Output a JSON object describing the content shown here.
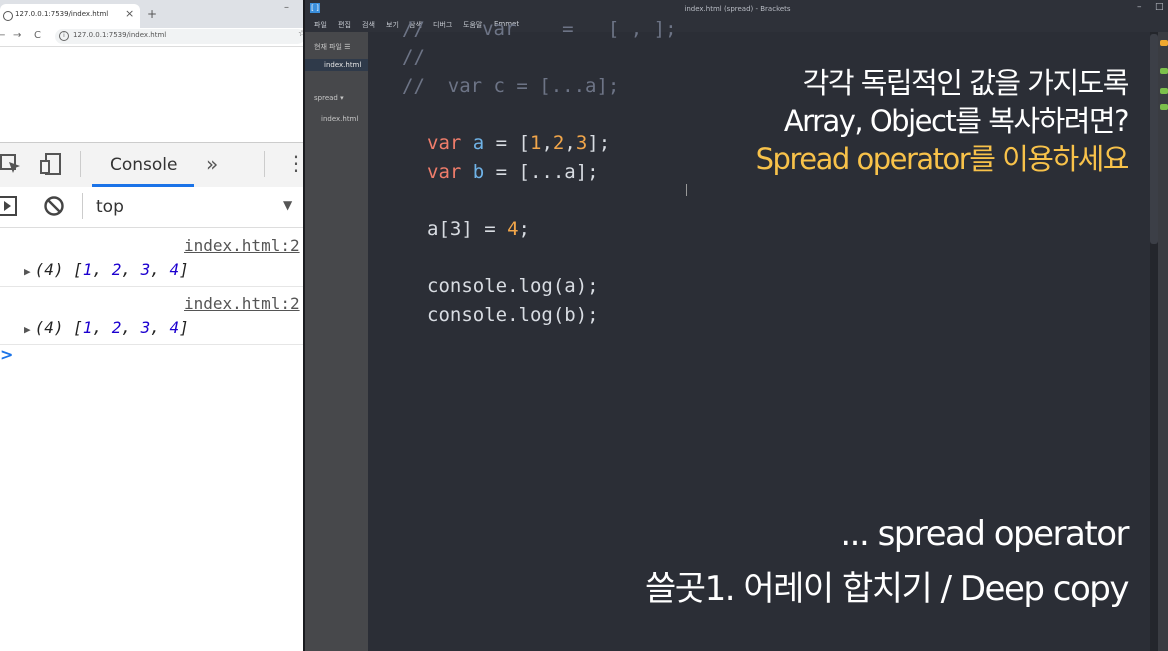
{
  "browser": {
    "tab_title": "127.0.0.1:7539/index.html",
    "tab_close": "×",
    "new_tab": "+",
    "minimize": "–",
    "back": "←",
    "forward": "→",
    "reload": "C",
    "url": "127.0.0.1:7539/index.html"
  },
  "devtools": {
    "console_tab": "Console",
    "more_tabs": "»",
    "context": "top",
    "logs": [
      {
        "source": "index.html:2",
        "count": "(4)",
        "values": [
          "1",
          "2",
          "3",
          "4"
        ]
      },
      {
        "source": "index.html:2",
        "count": "(4)",
        "values": [
          "1",
          "2",
          "3",
          "4"
        ]
      }
    ],
    "prompt": ">"
  },
  "editor": {
    "window_title": "index.html (spread) - Brackets",
    "menu": [
      "파일",
      "편집",
      "검색",
      "보기",
      "탐색",
      "디버그",
      "도움말",
      "Emmet"
    ],
    "sidebar_header": "현재 파일",
    "working_file": "index.html",
    "project": "spread",
    "project_file": "index.html",
    "code": {
      "partial_top": "//     var    =   [ , ];",
      "comment_empty": "//",
      "comment_c": "//  var c = [...a];",
      "line_a": {
        "kw": "var",
        "name": "a",
        "eq": " = [",
        "n1": "1",
        "n2": "2",
        "n3": "3",
        "end": "];"
      },
      "line_b": {
        "kw": "var",
        "name": "b",
        "rest": " = [...a];"
      },
      "line_assign": {
        "pre": "a[3] = ",
        "num": "4",
        "end": ";"
      },
      "log_a": "console.log(a);",
      "log_b": "console.log(b);"
    }
  },
  "captions": {
    "top_line1": "각각 독립적인 값을 가지도록",
    "top_line2": "Array, Object를 복사하려면?",
    "top_line3": "Spread operator를 이용하세요",
    "bottom_line1": "... spread operator",
    "bottom_line2": "쓸곳1. 어레이 합치기 / Deep copy"
  }
}
